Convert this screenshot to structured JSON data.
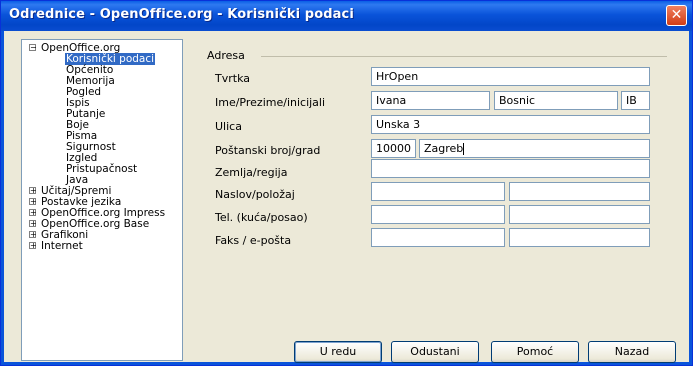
{
  "window": {
    "title": "Odrednice - OpenOffice.org - Korisnički podaci",
    "close_glyph": "✕"
  },
  "tree": {
    "root": "OpenOffice.org",
    "children": [
      "Korisnički podaci",
      "Općenito",
      "Memorija",
      "Pogled",
      "Ispis",
      "Putanje",
      "Boje",
      "Pisma",
      "Sigurnost",
      "Izgled",
      "Pristupačnost",
      "Java"
    ],
    "others": [
      "Učitaj/Spremi",
      "Postavke jezika",
      "OpenOffice.org Impress",
      "OpenOffice.org Base",
      "Grafikoni",
      "Internet"
    ],
    "expand_glyph": "+",
    "collapse_glyph": "−"
  },
  "form": {
    "group_label": "Adresa",
    "labels": {
      "company": "Tvrtka",
      "name": "Ime/Prezime/inicijali",
      "street": "Ulica",
      "postal": "Poštanski broj/grad",
      "country": "Zemlja/regija",
      "title": "Naslov/položaj",
      "phone": "Tel. (kuća/posao)",
      "fax": "Faks / e-pošta"
    },
    "values": {
      "company": "HrOpen",
      "first_name": "Ivana",
      "last_name": "Bosnic",
      "initials": "IB",
      "street": "Unska 3",
      "zip": "10000",
      "city": "Zagreb",
      "country": "",
      "title": "",
      "position": "",
      "phone_home": "",
      "phone_work": "",
      "fax": "",
      "email": ""
    }
  },
  "buttons": {
    "ok": "U redu",
    "cancel": "Odustani",
    "help": "Pomoć",
    "back": "Nazad"
  }
}
